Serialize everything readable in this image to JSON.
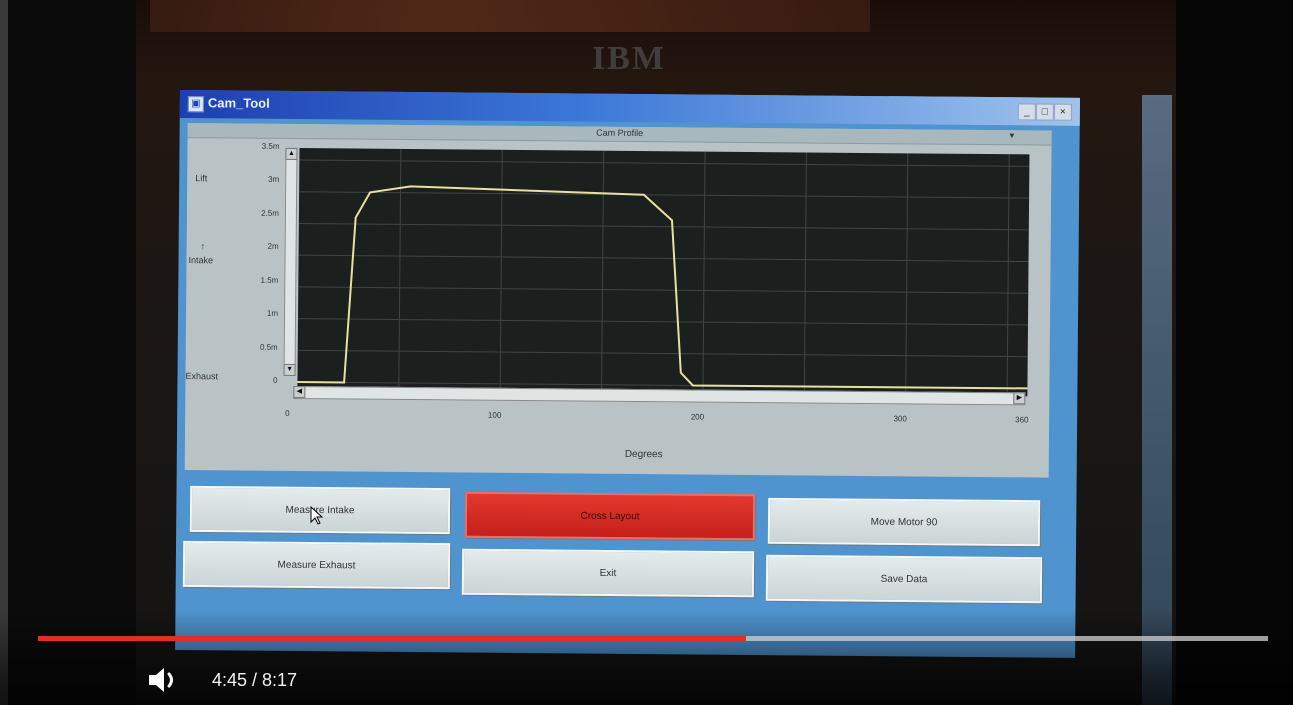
{
  "monitor": {
    "brand": "IBM"
  },
  "window": {
    "title": "Cam_Tool",
    "controls": {
      "minimize": "_",
      "maximize": "□",
      "close": "×"
    }
  },
  "plot": {
    "title": "Cam Profile",
    "y_labels": {
      "lift": "Lift",
      "intake": "Intake",
      "exhaust": "Exhaust"
    },
    "y_ticks": [
      "3.5m",
      "3m",
      "2.5m",
      "2m",
      "1.5m",
      "1m",
      "0.5m",
      "0"
    ],
    "x_ticks": [
      "0",
      "100",
      "200",
      "300",
      "360"
    ],
    "x_title": "Degrees"
  },
  "buttons": {
    "measure_intake": "Measure Intake",
    "cross_layout": "Cross Layout",
    "move_motor": "Move Motor 90",
    "measure_exhaust": "Measure Exhaust",
    "exit": "Exit",
    "save_data": "Save Data"
  },
  "player": {
    "progress_fraction": 0.576,
    "time": "4:45 / 8:17"
  },
  "colors": {
    "window_bg": "#4f93cf",
    "plot_bg": "#1b201e",
    "trace": "#e8e0a0",
    "active_button": "#d42a22",
    "progress": "#e52d27"
  },
  "chart_data": {
    "type": "line",
    "title": "Cam Profile",
    "xlabel": "Degrees",
    "ylabel": "",
    "xlim": [
      0,
      360
    ],
    "ylim": [
      0,
      3.5
    ],
    "x": [
      0,
      23,
      28,
      35,
      55,
      170,
      184,
      189,
      195,
      360
    ],
    "y": [
      0,
      0,
      2.6,
      3.0,
      3.1,
      3.0,
      2.6,
      0.2,
      0,
      0
    ]
  }
}
